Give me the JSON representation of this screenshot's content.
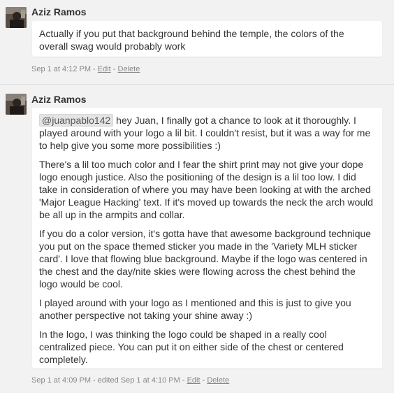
{
  "comments": [
    {
      "author": "Aziz Ramos",
      "paragraphs": [
        "Actually if you put that background behind the temple, the colors of the overall swag would probably work"
      ],
      "timestamp": "Sep 1 at 4:12 PM",
      "separator": " - ",
      "edit_label": "Edit",
      "delete_label": "Delete"
    },
    {
      "author": "Aziz Ramos",
      "mention": "@juanpablo142",
      "first_paragraph_rest": " hey Juan, I finally got a chance to look at it thoroughly. I played around with your logo a lil bit. I couldn't resist, but it was a way for me to help give you some more possibilities :)",
      "paragraphs": [
        "There's a lil too much color and I fear the shirt print may not give your dope logo enough justice. Also the positioning of the design is a lil too low. I did take in consideration of where you may have been looking at with the arched 'Major League Hacking' text. If it's moved up towards the neck the arch would be all up in the armpits and collar.",
        "If you do a color version, it's gotta have that awesome background technique you put on the space themed sticker you made in the 'Variety MLH sticker card'. I love that flowing blue background. Maybe if the logo was centered in the chest and the day/nite skies were flowing across the chest behind the logo would be cool.",
        "I played around with your logo as I mentioned and this is just to give you another perspective not taking your shine away :)",
        "In the logo, I was thinking the logo could be shaped in a really cool centralized piece. You can put it on either side of the chest or centered completely."
      ],
      "timestamp": "Sep 1 at 4:09 PM - edited Sep 1 at 4:10 PM",
      "separator": " - ",
      "edit_label": "Edit",
      "delete_label": "Delete"
    }
  ],
  "colors": {
    "background": "#f2f2f2",
    "bubble": "#ffffff",
    "text": "#333333",
    "meta": "#888888",
    "mention_bg": "#e4e4e4"
  }
}
